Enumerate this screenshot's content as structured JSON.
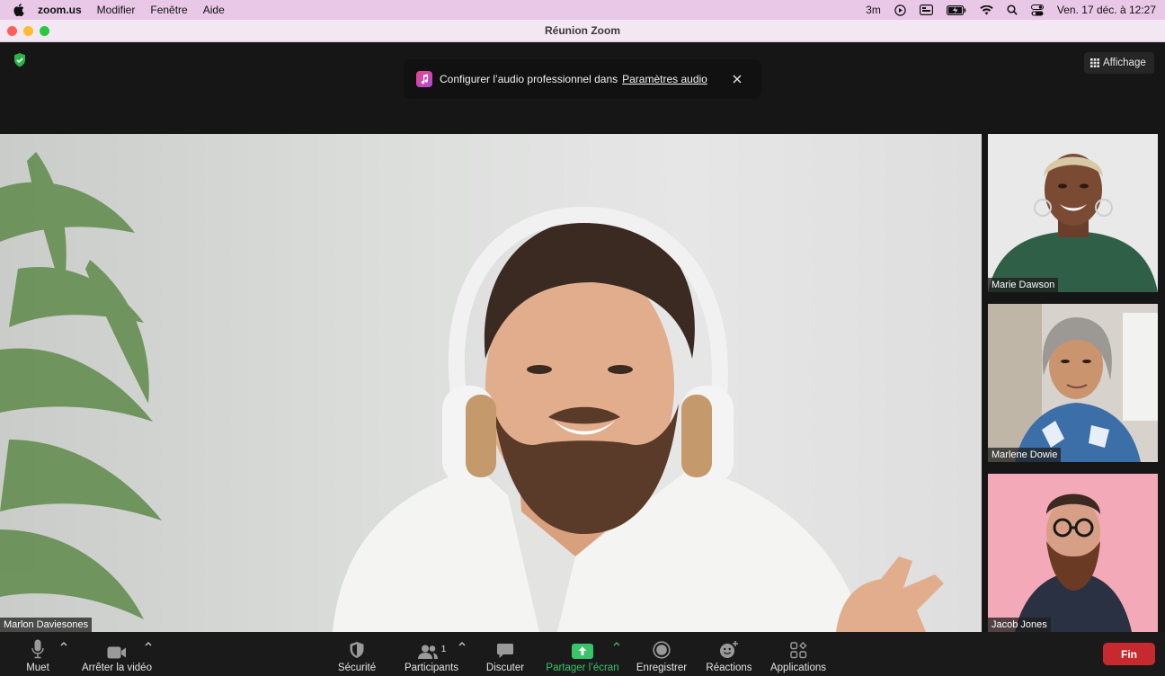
{
  "menubar": {
    "app_name": "zoom.us",
    "items": [
      "Modifier",
      "Fenêtre",
      "Aide"
    ],
    "status_text": "3m",
    "clock": "Ven. 17 déc. à  12:27"
  },
  "window": {
    "title": "Réunion Zoom"
  },
  "notice": {
    "text": "Configurer l’audio professionnel dans",
    "link": "Paramètres audio"
  },
  "view_button": {
    "label": "Affichage"
  },
  "main_speaker": {
    "name": "Marlon Daviesones"
  },
  "thumbnails": [
    {
      "name": "Marie Dawson"
    },
    {
      "name": "Marlene Dowie"
    },
    {
      "name": "Jacob Jones"
    }
  ],
  "toolbar": {
    "mute": "Muet",
    "stop_video": "Arrêter la vidéo",
    "security": "Sécurité",
    "participants": "Participants",
    "participants_count": "1",
    "chat": "Discuter",
    "share_screen": "Partager l’écran",
    "record": "Enregistrer",
    "reactions": "Réactions",
    "apps": "Applications",
    "end": "Fin"
  },
  "colors": {
    "menubar_bg": "#e8c8e6",
    "share_green": "#39c46a",
    "end_red": "#c62a2f",
    "shield_green": "#2bb34a"
  }
}
